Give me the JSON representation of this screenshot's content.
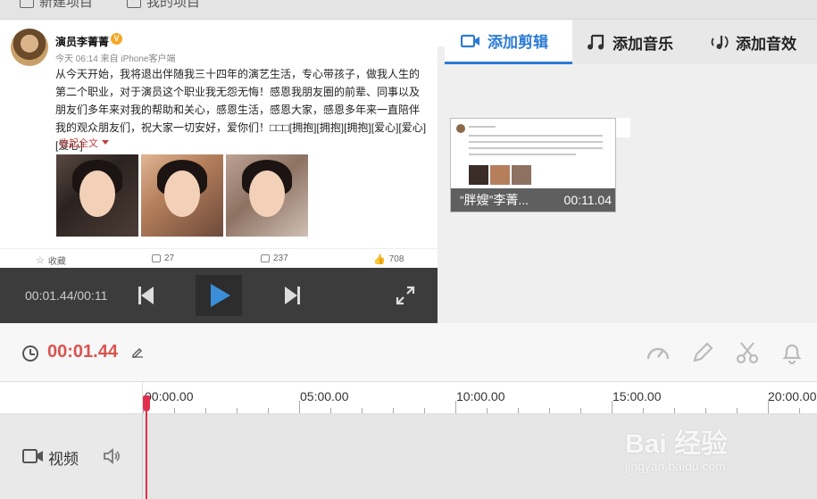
{
  "topbar": {
    "new_project": "新建项目",
    "my_projects": "我的项目"
  },
  "post": {
    "author": "演员李菁菁",
    "verified_mark": "V",
    "meta": "今天 06:14 来自 iPhone客户端",
    "text": "从今天开始，我将退出伴随我三十四年的演艺生活，专心带孩子，做我人生的第二个职业，对于演员这个职业我无怨无悔！感恩我朋友圈的前辈、同事以及朋友们多年来对我的帮助和关心，感恩生活，感恩大家，感恩多年来一直陪伴我的观众朋友们，祝大家一切安好，爱你们！□□□[拥抱][拥抱][拥抱][爱心][爱心][爱心]",
    "collapse": "收起全文",
    "actions": {
      "favorite": "收藏",
      "repost": "27",
      "comment": "237",
      "like": "708"
    }
  },
  "player": {
    "timecode": "00:01.44/00:11"
  },
  "tabs": [
    {
      "label": "添加剪辑",
      "icon": "video-camera-icon",
      "active": true
    },
    {
      "label": "添加音乐",
      "icon": "music-note-icon",
      "active": false
    },
    {
      "label": "添加音效",
      "icon": "sound-effect-icon",
      "active": false
    }
  ],
  "library": {
    "clips": [
      {
        "title": "“胖嫂”李菁...",
        "duration": "00:11.04"
      }
    ]
  },
  "timeline": {
    "current_time": "00:01.44",
    "ruler_labels": [
      "00:00.00",
      "05:00.00",
      "10:00.00",
      "15:00.00",
      "20:00.00"
    ],
    "track_name": "视频"
  },
  "watermark": {
    "text": "Bai 经验",
    "sub": "jingyan.baidu.com"
  },
  "colors": {
    "accent_blue": "#2b7bd6",
    "time_red": "#d9534f",
    "playhead": "#e0304e"
  }
}
